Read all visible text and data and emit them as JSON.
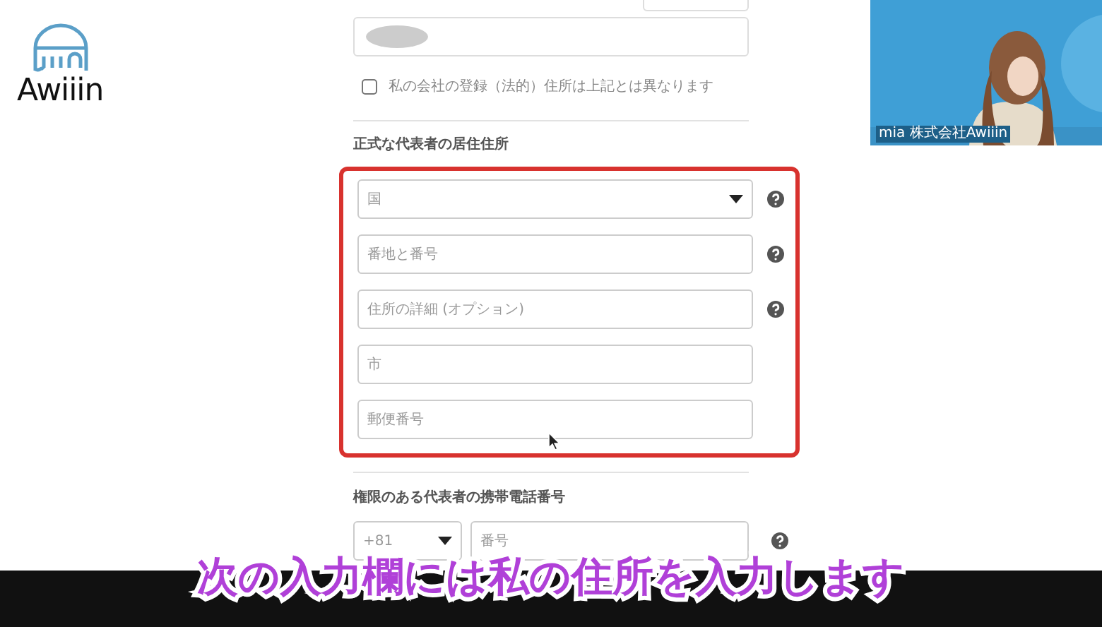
{
  "logo": {
    "text": "Awiiin"
  },
  "webcam": {
    "caption": "mia 株式会社Awiiin"
  },
  "form": {
    "registered_address_checkbox": {
      "label": "私の会社の登録（法的）住所は上記とは異なります",
      "checked": false
    },
    "representative_address": {
      "heading": "正式な代表者の居住住所",
      "highlighted": true,
      "fields": [
        {
          "kind": "select",
          "placeholder": "国",
          "help": true
        },
        {
          "kind": "input",
          "placeholder": "番地と番号",
          "help": true
        },
        {
          "kind": "input",
          "placeholder": "住所の詳細 (オプション)",
          "help": true
        },
        {
          "kind": "input",
          "placeholder": "市",
          "help": false
        },
        {
          "kind": "input",
          "placeholder": "郵便番号",
          "help": false
        }
      ]
    },
    "phone": {
      "heading": "権限のある代表者の携帯電話番号",
      "country_code": "+81",
      "placeholder": "番号",
      "help": true
    }
  },
  "subtitle": "次の入力欄には私の住所を入力します"
}
